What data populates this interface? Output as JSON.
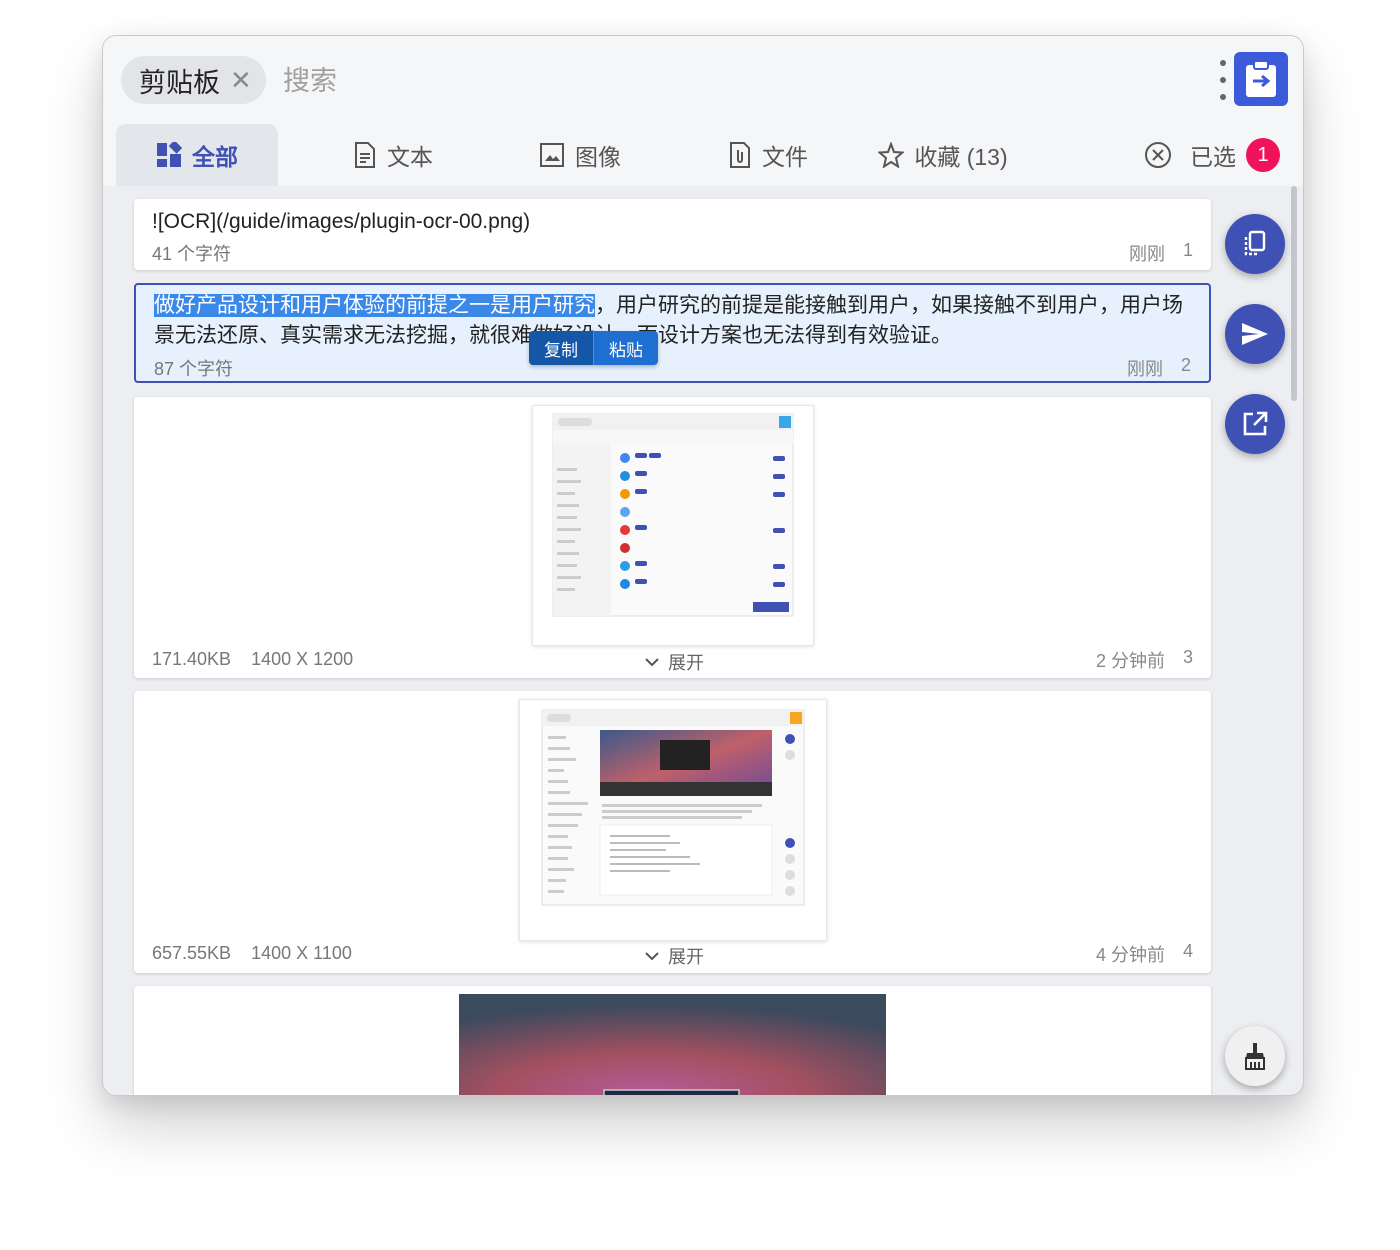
{
  "header": {
    "chip_label": "剪贴板",
    "search_placeholder": "搜索"
  },
  "tabs": [
    {
      "label": "全部",
      "icon": "dashboard-icon",
      "active": true
    },
    {
      "label": "文本",
      "icon": "document-icon"
    },
    {
      "label": "图像",
      "icon": "image-icon"
    },
    {
      "label": "文件",
      "icon": "attachment-icon"
    },
    {
      "label": "收藏 (13)",
      "icon": "star-icon"
    }
  ],
  "selected": {
    "label": "已选",
    "count": "1"
  },
  "items": [
    {
      "text": "![OCR](/guide/images/plugin-ocr-00.png)",
      "meta": "41 个字符",
      "time": "刚刚",
      "index": "1"
    },
    {
      "text_highlight": "做好产品设计和用户体验的前提之一是用户研究",
      "text_rest_1": "，用户研究的前提是能接触到用户，如果接触不到用户，用户场",
      "text_line2": "景无法还原、真实需求无法挖掘，就很难做好设计，而设计方案也无法得到有效验证。",
      "meta": "87 个字符",
      "time": "刚刚",
      "index": "2",
      "actions": [
        "复制",
        "粘贴"
      ]
    },
    {
      "size": "171.40KB",
      "dimensions": "1400 X 1200",
      "expand": "展开",
      "time": "2 分钟前",
      "index": "3"
    },
    {
      "size": "657.55KB",
      "dimensions": "1400 X 1100",
      "expand": "展开",
      "time": "4 分钟前",
      "index": "4"
    }
  ],
  "colors": {
    "accent": "#3f51b5",
    "badge": "#f0135c",
    "selection": "#3a88e8"
  }
}
